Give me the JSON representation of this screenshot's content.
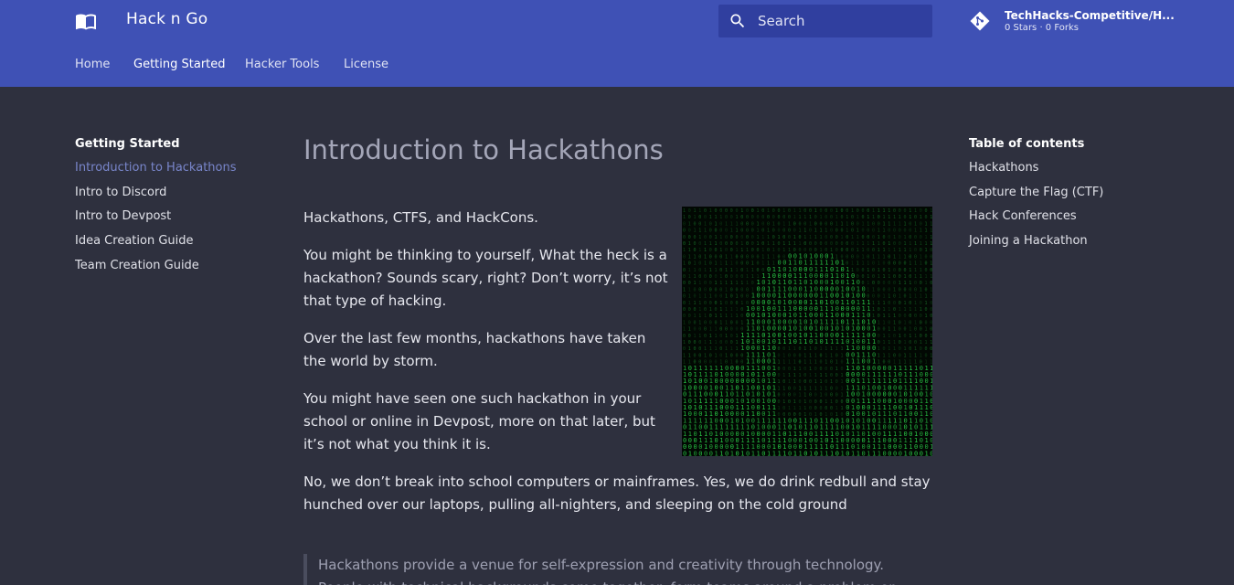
{
  "header": {
    "site_title": "Hack n Go",
    "logo_icon": "book-open-icon",
    "search": {
      "placeholder": "Search",
      "icon": "search-icon"
    },
    "repo": {
      "icon": "git-icon",
      "name": "TechHacks-Competitive/H...",
      "facts": "0 Stars · 0 Forks"
    }
  },
  "tabs": [
    {
      "label": "Home",
      "active": false
    },
    {
      "label": "Getting Started",
      "active": true
    },
    {
      "label": "Hacker Tools",
      "active": false
    },
    {
      "label": "License",
      "active": false
    }
  ],
  "nav": {
    "title": "Getting Started",
    "items": [
      {
        "label": "Introduction to Hackathons",
        "active": true
      },
      {
        "label": "Intro to Discord",
        "active": false
      },
      {
        "label": "Intro to Devpost",
        "active": false
      },
      {
        "label": "Idea Creation Guide",
        "active": false
      },
      {
        "label": "Team Creation Guide",
        "active": false
      }
    ]
  },
  "toc": {
    "title": "Table of contents",
    "items": [
      "Hackathons",
      "Capture the Flag (CTF)",
      "Hack Conferences",
      "Joining a Hackathon"
    ]
  },
  "content": {
    "title": "Introduction to Hackathons",
    "paragraphs": [
      "Hackathons, CTFS, and HackCons.",
      "You might be thinking to yourself, What the heck is a hackathon? Sounds scary, right? Don’t worry, it’s not that type of hacking.",
      "Over the last few months, hackathons have taken the world by storm.",
      "You might have seen one such hackathon in your school or online in Devpost, more on that later, but it’s not what you think it is.",
      "No, we don’t break into school computers or mainframes. Yes, we do drink redbull and stay hunched over our laptops, pulling all-nighters, and sleeping on the cold ground"
    ],
    "quote": "Hackathons provide a venue for self-expression and creativity through technology. People with technical backgrounds come together, form teams around a problem or idea, and",
    "image": {
      "description_icon": "binary-hacker-image",
      "accent_color": "#2bd14a"
    }
  },
  "colors": {
    "header": "#3f51b5",
    "search": "#303f9f",
    "background": "#2e303e",
    "active_link": "#7986cb"
  }
}
